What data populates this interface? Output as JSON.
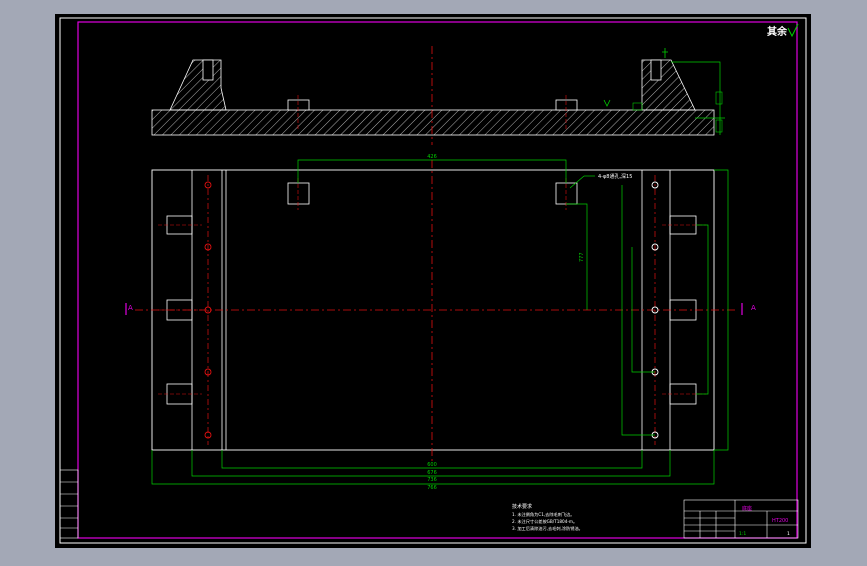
{
  "drawing": {
    "corner_mark": "其余",
    "section_marker": "A",
    "annotations": {
      "top_dimension": "426",
      "side_dimension": "777",
      "hole_note": "4-φ8通孔,深15"
    },
    "bottom_dimensions": [
      "600",
      "676",
      "736",
      "766"
    ],
    "tech_requirements": {
      "heading": "技术要求",
      "lines": [
        "1. 未注倒角为C1,去除毛刺飞边。",
        "2. 未注尺寸公差按GB/T1804-m。",
        "3. 加工后清除油污,去毛刺,涂防锈油。"
      ]
    },
    "title_block": {
      "part_name": "底座",
      "material": "HT200",
      "scale": "1:1",
      "sheet": "1"
    }
  },
  "colors": {
    "sheet": "#000000",
    "border": "#e000e0",
    "outline": "#ffffff",
    "dimension": "#00d000",
    "centerline": "#e01010",
    "hatch": "#ffffff",
    "frame_background": "#a3a8b6"
  }
}
